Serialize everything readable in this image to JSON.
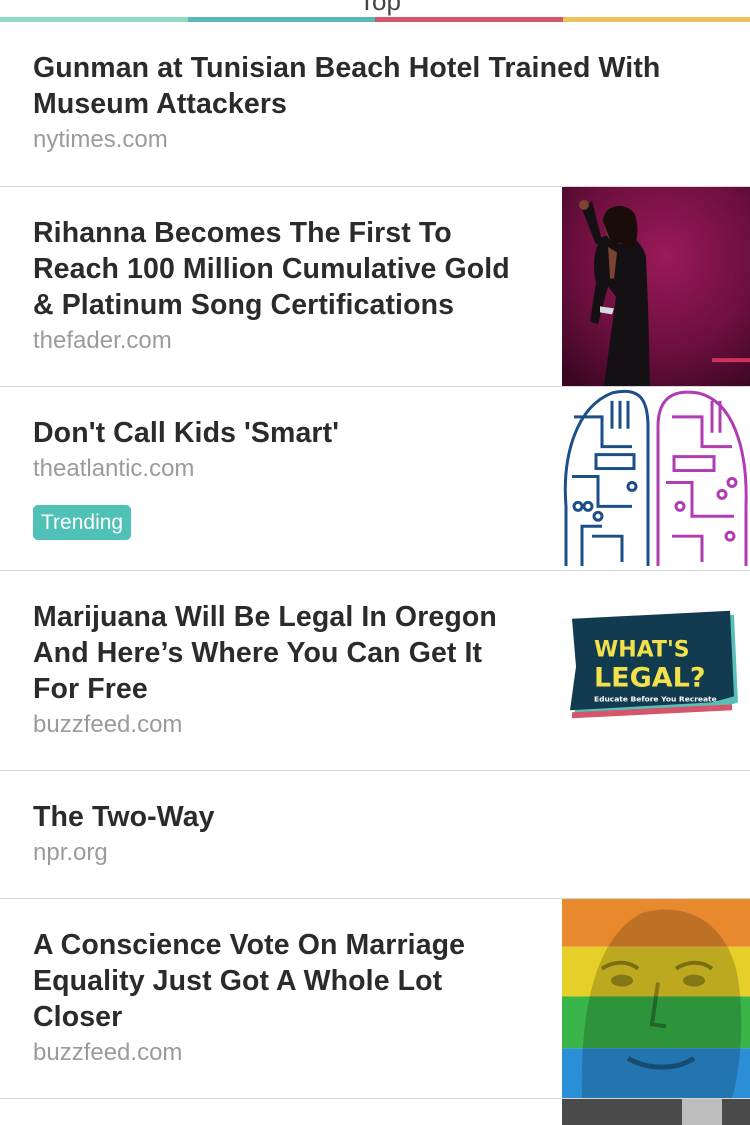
{
  "header": {
    "title": "Top",
    "accent_colors": [
      "#8fdcc0",
      "#5bb8b8",
      "#d4566a",
      "#ecc35a"
    ]
  },
  "articles": [
    {
      "headline": "Gunman at Tunisian Beach Hotel Trained With Museum Attackers",
      "source": "nytimes.com",
      "image": null
    },
    {
      "headline": "Rihanna Becomes The First To Reach 100 Million Cumulative Gold & Platinum Song Certifications",
      "source": "thefader.com",
      "image": "performer-on-stage-photo"
    },
    {
      "headline": "Don't Call Kids 'Smart'",
      "source": "theatlantic.com",
      "badge": "Trending",
      "image": "circuit-brain-illustration"
    },
    {
      "headline": "Marijuana Will Be Legal In Oregon And Here’s Where You Can Get It For Free",
      "source": "buzzfeed.com",
      "image": "whats-legal-logo",
      "image_text": {
        "line1": "WHAT'S",
        "line2": "LEGAL?",
        "tagline": "Educate Before You Recreate"
      }
    },
    {
      "headline": "The Two-Way",
      "source": "npr.org",
      "image": null
    },
    {
      "headline": "A Conscience Vote On Marriage Equality Just Got A Whole Lot Closer",
      "source": "buzzfeed.com",
      "image": "rainbow-portrait-photo"
    }
  ]
}
